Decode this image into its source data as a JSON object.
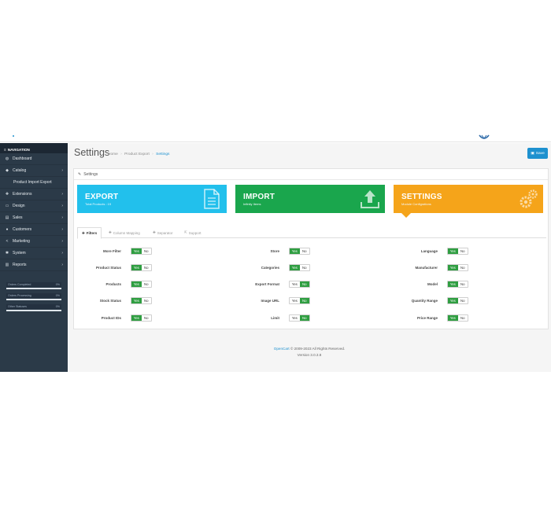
{
  "navigation": {
    "heading": "NAVIGATION",
    "items": [
      {
        "label": "Dashboard",
        "icon": "dashboard-icon",
        "glyph": "◍",
        "chevron": ""
      },
      {
        "label": "Catalog",
        "icon": "tag-icon",
        "glyph": "◆",
        "chevron": "›"
      },
      {
        "label": "Product Import Export",
        "icon": "",
        "glyph": "",
        "chevron": ""
      },
      {
        "label": "Extensions",
        "icon": "puzzle-icon",
        "glyph": "✚",
        "chevron": "›"
      },
      {
        "label": "Design",
        "icon": "monitor-icon",
        "glyph": "▭",
        "chevron": "›"
      },
      {
        "label": "Sales",
        "icon": "cart-icon",
        "glyph": "▤",
        "chevron": "›"
      },
      {
        "label": "Customers",
        "icon": "user-icon",
        "glyph": "●",
        "chevron": "›"
      },
      {
        "label": "Marketing",
        "icon": "share-icon",
        "glyph": "<",
        "chevron": "›"
      },
      {
        "label": "System",
        "icon": "gear-icon",
        "glyph": "✱",
        "chevron": "›"
      },
      {
        "label": "Reports",
        "icon": "bar-chart-icon",
        "glyph": "▥",
        "chevron": "›"
      }
    ],
    "stats": [
      {
        "label": "Orders Completed",
        "value": "0%",
        "fraction": 0
      },
      {
        "label": "Orders Processing",
        "value": "0%",
        "fraction": 0
      },
      {
        "label": "Other Statuses",
        "value": "0%",
        "fraction": 0
      }
    ]
  },
  "header": {
    "title": "Settings",
    "breadcrumbs": [
      "Home",
      "Product Export",
      "Settings"
    ],
    "save_label": "Save"
  },
  "panel": {
    "title": "Settings"
  },
  "tiles": [
    {
      "title": "EXPORT",
      "subtitle": "Total Products : 19",
      "color": "#22c0ec",
      "icon": "document-icon"
    },
    {
      "title": "IMPORT",
      "subtitle": "Infinity Items",
      "color": "#1aa64d",
      "icon": "upload-icon"
    },
    {
      "title": "SETTINGS",
      "subtitle": "Module Configrations",
      "color": "#f5a41a",
      "icon": "gears-icon"
    }
  ],
  "tabs": [
    {
      "label": "Filters",
      "active": true
    },
    {
      "label": "Column Mapping",
      "active": false
    },
    {
      "label": "Separator",
      "active": false
    },
    {
      "label": "Support",
      "active": false
    }
  ],
  "toggle_labels": {
    "yes": "Yes",
    "no": "No"
  },
  "filters": {
    "col1": [
      {
        "label": "More Filter",
        "value": "Yes"
      },
      {
        "label": "Product Status",
        "value": "Yes"
      },
      {
        "label": "Products",
        "value": "Yes"
      },
      {
        "label": "Stock Status",
        "value": "Yes"
      },
      {
        "label": "Product IDs",
        "value": "Yes"
      }
    ],
    "col2": [
      {
        "label": "Store",
        "value": "Yes"
      },
      {
        "label": "Categories",
        "value": "Yes"
      },
      {
        "label": "Export Format",
        "value": "No"
      },
      {
        "label": "Image URL",
        "value": "No"
      },
      {
        "label": "Limit",
        "value": "No"
      }
    ],
    "col3": [
      {
        "label": "Language",
        "value": "Yes"
      },
      {
        "label": "Manufacturer",
        "value": "Yes"
      },
      {
        "label": "Model",
        "value": "Yes"
      },
      {
        "label": "Quantity Range",
        "value": "Yes"
      },
      {
        "label": "Price Range",
        "value": "Yes"
      }
    ]
  },
  "footer": {
    "link": "OpenCart",
    "copyright": " © 2009-2023 All Rights Reserved.",
    "version": "Version 3.0.3.8"
  },
  "colors": {
    "accent": "#1e91cf",
    "toggle_on": "#2f9e41",
    "sidebar": "#2b3a48"
  }
}
